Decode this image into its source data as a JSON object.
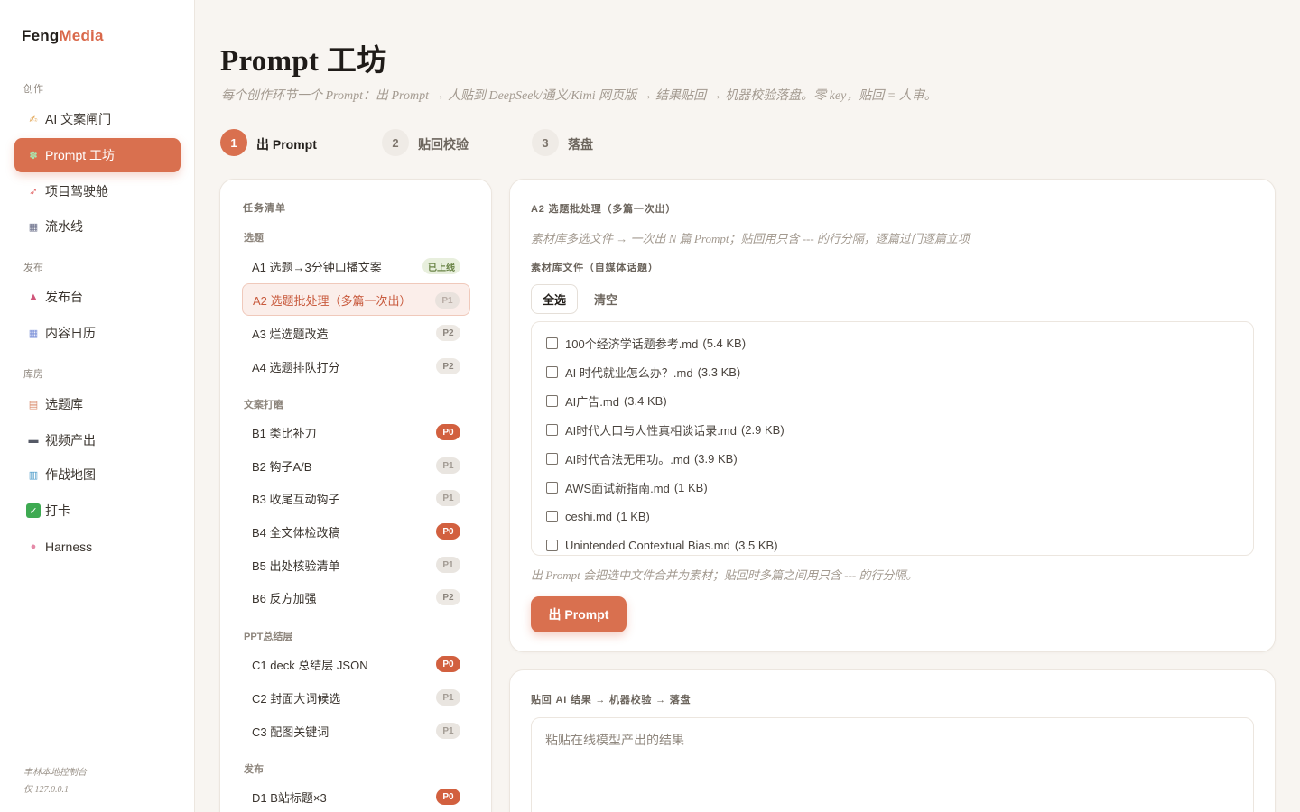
{
  "brand": {
    "part1": "Feng",
    "part2": "Media"
  },
  "sidebar": {
    "sections": [
      {
        "label": "创作"
      },
      {
        "label": "发布"
      },
      {
        "label": "库房"
      }
    ],
    "items": [
      {
        "icon": "writing-hand-icon",
        "glyph": "✍",
        "color": "#e0a04a",
        "label": "AI 文案闸门"
      },
      {
        "icon": "puzzle-icon",
        "glyph": "✽",
        "color": "#7fcf8a",
        "label": "Prompt 工坊"
      },
      {
        "icon": "rocket-icon",
        "glyph": "➶",
        "color": "#e05a5a",
        "label": "项目驾驶舱"
      },
      {
        "icon": "clapper-icon",
        "glyph": "▦",
        "color": "#6b6f8a",
        "label": "流水线"
      },
      {
        "icon": "outbox-icon",
        "glyph": "▲",
        "color": "#d0567a",
        "label": "发布台"
      },
      {
        "icon": "calendar-icon",
        "glyph": "▦",
        "color": "#7a8fd8",
        "label": "内容日历"
      },
      {
        "icon": "memo-icon",
        "glyph": "▤",
        "color": "#d88a6a",
        "label": "选题库"
      },
      {
        "icon": "video-camera-icon",
        "glyph": "▬",
        "color": "#555a66",
        "label": "视频产出"
      },
      {
        "icon": "map-icon",
        "glyph": "▥",
        "color": "#4a9ac8",
        "label": "作战地图"
      },
      {
        "icon": "check-box-icon",
        "glyph": "✓",
        "color": "#3eaa52",
        "label": "打卡"
      },
      {
        "icon": "brain-icon",
        "glyph": "●",
        "color": "#e58aa8",
        "label": "Harness"
      }
    ],
    "footer": {
      "line1": "丰林本地控制台",
      "line2": "仅 127.0.0.1"
    }
  },
  "page": {
    "title": "Prompt 工坊",
    "subtitle": "每个创作环节一个 Prompt：出 Prompt → 人贴到 DeepSeek/通义/Kimi 网页版 → 结果贴回 → 机器校验落盘。零 key，贴回 = 人审。"
  },
  "steps": [
    {
      "num": "1",
      "label": "出 Prompt"
    },
    {
      "num": "2",
      "label": "贴回校验"
    },
    {
      "num": "3",
      "label": "落盘"
    }
  ],
  "tasks": {
    "header": "任务清单",
    "groups": [
      {
        "label": "选题"
      },
      {
        "label": "文案打磨"
      },
      {
        "label": "PPT总结层"
      },
      {
        "label": "发布"
      }
    ],
    "rows": [
      {
        "label": "A1 选题→3分钟口播文案",
        "badge": "已上线"
      },
      {
        "label": "A2 选题批处理（多篇一次出）",
        "badge": "P1"
      },
      {
        "label": "A3 烂选题改造",
        "badge": "P2"
      },
      {
        "label": "A4 选题排队打分",
        "badge": "P2"
      },
      {
        "label": "B1 类比补刀",
        "badge": "P0"
      },
      {
        "label": "B2 钩子A/B",
        "badge": "P1"
      },
      {
        "label": "B3 收尾互动钩子",
        "badge": "P1"
      },
      {
        "label": "B4 全文体检改稿",
        "badge": "P0"
      },
      {
        "label": "B5 出处核验清单",
        "badge": "P1"
      },
      {
        "label": "B6 反方加强",
        "badge": "P2"
      },
      {
        "label": "C1 deck 总结层 JSON",
        "badge": "P0"
      },
      {
        "label": "C2 封面大词候选",
        "badge": "P1"
      },
      {
        "label": "C3 配图关键词",
        "badge": "P1"
      },
      {
        "label": "D1 B站标题×3",
        "badge": "P0"
      }
    ]
  },
  "detail": {
    "heading": "A2 选题批处理（多篇一次出）",
    "description": "素材库多选文件 → 一次出 N 篇 Prompt；贴回用只含 --- 的行分隔，逐篇过门逐篇立项",
    "source_label": "素材库文件（自媒体话题）",
    "select_all": "全选",
    "clear": "清空",
    "files": [
      {
        "name": "100个经济学话题参考.md",
        "size": "(5.4 KB)"
      },
      {
        "name": "AI 时代就业怎么办？.md",
        "size": "(3.3 KB)"
      },
      {
        "name": "AI广告.md",
        "size": "(3.4 KB)"
      },
      {
        "name": "AI时代人口与人性真相谈话录.md",
        "size": "(2.9 KB)"
      },
      {
        "name": "AI时代合法无用功。.md",
        "size": "(3.9 KB)"
      },
      {
        "name": "AWS面试新指南.md",
        "size": "(1 KB)"
      },
      {
        "name": "ceshi.md",
        "size": "(1 KB)"
      },
      {
        "name": "Unintended Contextual Bias.md",
        "size": "(3.5 KB)"
      }
    ],
    "note": "出 Prompt 会把选中文件合并为素材；贴回时多篇之间用只含 --- 的行分隔。",
    "prompt_button": "出 Prompt"
  },
  "paste": {
    "heading": "贴回 AI 结果 → 机器校验 → 落盘",
    "placeholder": "粘贴在线模型产出的结果"
  },
  "colors": {
    "accent": "#d9704f",
    "p0": "#d2603f",
    "live": "#6b8548"
  }
}
